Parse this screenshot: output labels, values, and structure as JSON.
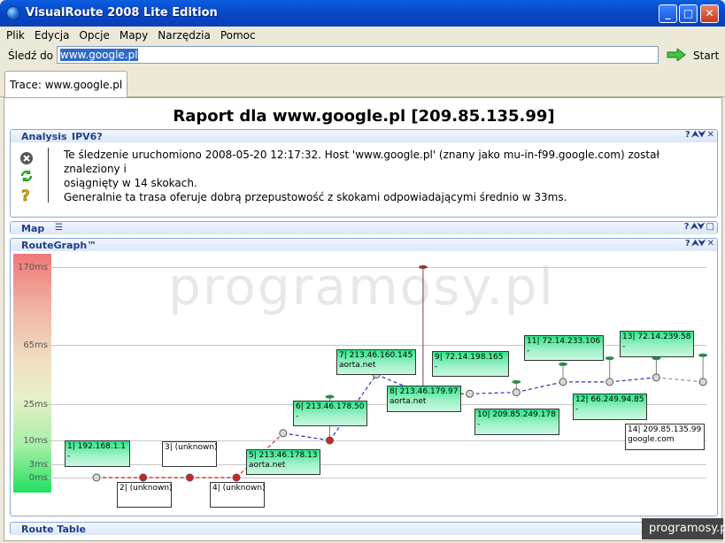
{
  "window": {
    "title": "VisualRoute 2008 Lite Edition"
  },
  "menu": [
    "Plik",
    "Edycja",
    "Opcje",
    "Mapy",
    "Narzędzia",
    "Pomoc"
  ],
  "trace": {
    "label": "Śledź do",
    "value": "www.google.pl",
    "start": "Start"
  },
  "tab": {
    "label": "Trace: www.google.pl"
  },
  "report": {
    "title": "Raport dla www.google.pl [209.85.135.99]"
  },
  "analysis": {
    "title": "Analysis",
    "tab2": "IPV6?",
    "line1": "Te śledzenie uruchomiono 2008-05-20 12:17:32. Host 'www.google.pl' (znany jako mu-in-f99.google.com) został znaleziony i",
    "line2": "osiągnięty w 14 skokach.",
    "line3": "Generalnie ta trasa oferuje dobrą przepustowość z skokami odpowiadającymi średnio w 33ms.",
    "icons": [
      "close-circle-icon",
      "refresh-icon",
      "question-icon"
    ]
  },
  "map": {
    "title": "Map"
  },
  "routegraph": {
    "title": "RouteGraph™",
    "watermark": "programosy.pl",
    "yaxis": [
      "170ms",
      "65ms",
      "25ms",
      "10ms",
      "3ms",
      "0ms"
    ]
  },
  "routetable": {
    "title": "Route Table"
  },
  "chart_data": {
    "type": "line",
    "ylabel": "",
    "yticks": [
      "0ms",
      "3ms",
      "10ms",
      "25ms",
      "65ms",
      "170ms"
    ],
    "hops": [
      {
        "hop": 1,
        "ip": "192.168.1.1",
        "name": "",
        "ms": 0
      },
      {
        "hop": 2,
        "ip": "(unknown)",
        "name": "",
        "ms": 0
      },
      {
        "hop": 3,
        "ip": "(unknown)",
        "name": "",
        "ms": 0
      },
      {
        "hop": 4,
        "ip": "(unknown)",
        "name": "",
        "ms": 0
      },
      {
        "hop": 5,
        "ip": "213.46.178.13",
        "name": "aorta.net",
        "ms": 13
      },
      {
        "hop": 6,
        "ip": "213.46.178.50",
        "name": "",
        "ms": 10
      },
      {
        "hop": 7,
        "ip": "213.46.160.145",
        "name": "aorta.net",
        "ms": 45
      },
      {
        "hop": 8,
        "ip": "213.46.179.97",
        "name": "aorta.net",
        "ms": 32
      },
      {
        "hop": 9,
        "ip": "72.14.198.165",
        "name": "",
        "ms": 32
      },
      {
        "hop": 10,
        "ip": "209.85.249.178",
        "name": "",
        "ms": 33
      },
      {
        "hop": 11,
        "ip": "72.14.233.106",
        "name": "",
        "ms": 40
      },
      {
        "hop": 12,
        "ip": "66.249.94.85",
        "name": "",
        "ms": 40
      },
      {
        "hop": 13,
        "ip": "72.14.239.58",
        "name": "",
        "ms": 43
      },
      {
        "hop": 14,
        "ip": "209.85.135.99",
        "name": "google.com",
        "ms": 40
      }
    ]
  },
  "corner_watermark": "programosy.pl"
}
